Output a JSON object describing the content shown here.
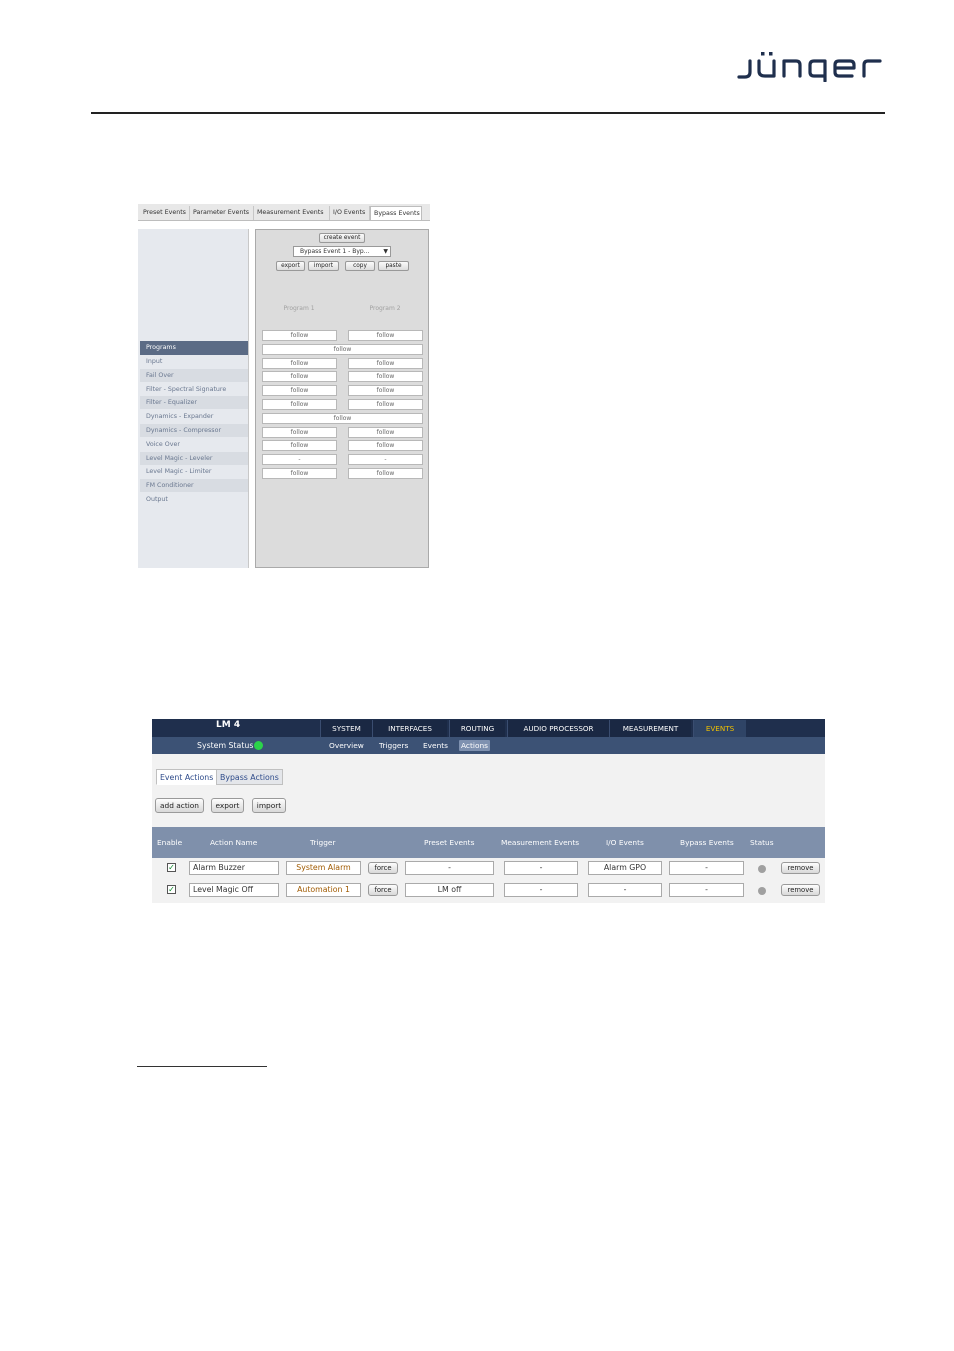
{
  "page": {
    "brand": "jünger"
  },
  "bypass_screen": {
    "tabs": [
      "Preset Events",
      "Parameter Events",
      "Measurement Events",
      "I/O Events",
      "Bypass Events"
    ],
    "active_tab": "Bypass Events",
    "buttons": {
      "create": "create event",
      "export": "export",
      "import": "import",
      "copy": "copy",
      "paste": "paste"
    },
    "selected_event": "Bypass Event 1 - Byp...",
    "columns": [
      "Program 1",
      "Program 2"
    ],
    "section_header": "Programs",
    "rows": [
      {
        "label": "Input",
        "p1": "follow",
        "p2": "follow",
        "merged": false
      },
      {
        "label": "Fail Over",
        "p1": "follow",
        "p2": "",
        "merged": true
      },
      {
        "label": "Filter - Spectral Signature",
        "p1": "follow",
        "p2": "follow",
        "merged": false
      },
      {
        "label": "Filter - Equalizer",
        "p1": "follow",
        "p2": "follow",
        "merged": false
      },
      {
        "label": "Dynamics - Expander",
        "p1": "follow",
        "p2": "follow",
        "merged": false
      },
      {
        "label": "Dynamics - Compressor",
        "p1": "follow",
        "p2": "follow",
        "merged": false
      },
      {
        "label": "Voice Over",
        "p1": "follow",
        "p2": "",
        "merged": true
      },
      {
        "label": "Level Magic - Leveler",
        "p1": "follow",
        "p2": "follow",
        "merged": false
      },
      {
        "label": "Level Magic - Limiter",
        "p1": "follow",
        "p2": "follow",
        "merged": false
      },
      {
        "label": "FM Conditioner",
        "p1": "-",
        "p2": "-",
        "merged": false
      },
      {
        "label": "Output",
        "p1": "follow",
        "p2": "follow",
        "merged": false
      }
    ]
  },
  "actions_screen": {
    "device": "LM 4",
    "nav": [
      "SYSTEM",
      "INTERFACES",
      "ROUTING",
      "AUDIO PROCESSOR",
      "MEASUREMENT",
      "EVENTS"
    ],
    "active_nav": "EVENTS",
    "system_status": "System Status",
    "status_color": "#2bd34a",
    "subnav": [
      "Overview",
      "Triggers",
      "Events",
      "Actions"
    ],
    "active_subnav": "Actions",
    "tabs": [
      "Event Actions",
      "Bypass Actions"
    ],
    "active_tab": "Event Actions",
    "buttons": {
      "add": "add action",
      "export": "export",
      "import": "import"
    },
    "columns": [
      "Enable",
      "Action Name",
      "Trigger",
      "Preset Events",
      "Measurement Events",
      "I/O Events",
      "Bypass Events",
      "Status"
    ],
    "rows": [
      {
        "enabled": true,
        "name": "Alarm Buzzer",
        "trigger": "System Alarm",
        "force": "force",
        "preset": "-",
        "measurement": "-",
        "io": "Alarm GPO",
        "bypass": "-",
        "remove": "remove"
      },
      {
        "enabled": true,
        "name": "Level Magic Off",
        "trigger": "Automation 1",
        "force": "force",
        "preset": "LM off",
        "measurement": "-",
        "io": "-",
        "bypass": "-",
        "remove": "remove"
      }
    ]
  }
}
